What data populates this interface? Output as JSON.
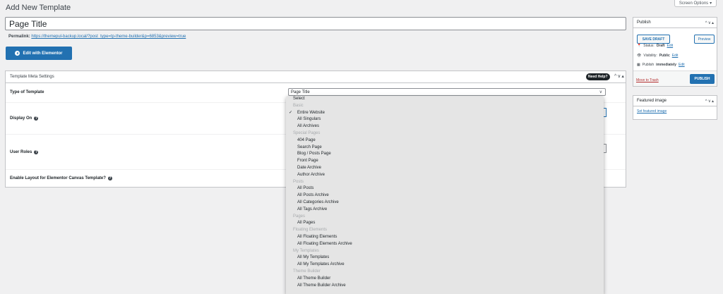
{
  "header": {
    "page_title": "Add New Template",
    "screen_options": "Screen Options"
  },
  "editor": {
    "title_value": "Page Title",
    "permalink_label": "Permalink:",
    "permalink_url": "https://themepul-backup.local/?post_type=tp-theme-builder&p=6853&preview=true",
    "elementor_button": "Edit with Elementor"
  },
  "meta_box": {
    "title": "Template Meta Settings",
    "need_help": "Need Help?",
    "rows": {
      "type_label": "Type of Template",
      "display_label": "Display On",
      "roles_label": "User Roles",
      "canvas_label": "Enable Layout for Elementor Canvas Template?"
    },
    "type_select_value": "Page Title"
  },
  "dropdown": {
    "items": [
      {
        "kind": "top",
        "label": "Select"
      },
      {
        "kind": "group",
        "label": "Basic"
      },
      {
        "kind": "opt",
        "label": "Entire Website",
        "checked": true
      },
      {
        "kind": "opt",
        "label": "All Singulars"
      },
      {
        "kind": "opt",
        "label": "All Archives"
      },
      {
        "kind": "group",
        "label": "Special Pages"
      },
      {
        "kind": "opt",
        "label": "404 Page"
      },
      {
        "kind": "opt",
        "label": "Search Page"
      },
      {
        "kind": "opt",
        "label": "Blog / Posts Page"
      },
      {
        "kind": "opt",
        "label": "Front Page"
      },
      {
        "kind": "opt",
        "label": "Date Archive"
      },
      {
        "kind": "opt",
        "label": "Author Archive"
      },
      {
        "kind": "group",
        "label": "Posts"
      },
      {
        "kind": "opt",
        "label": "All Posts"
      },
      {
        "kind": "opt",
        "label": "All Posts Archive"
      },
      {
        "kind": "opt",
        "label": "All Categories Archive"
      },
      {
        "kind": "opt",
        "label": "All Tags Archive"
      },
      {
        "kind": "group",
        "label": "Pages"
      },
      {
        "kind": "opt",
        "label": "All Pages"
      },
      {
        "kind": "group",
        "label": "Floating Elements"
      },
      {
        "kind": "opt",
        "label": "All Floating Elements"
      },
      {
        "kind": "opt",
        "label": "All Floating Elements Archive"
      },
      {
        "kind": "group",
        "label": "My Templates"
      },
      {
        "kind": "opt",
        "label": "All My Templates"
      },
      {
        "kind": "opt",
        "label": "All My Templates Archive"
      },
      {
        "kind": "group",
        "label": "Theme Builder"
      },
      {
        "kind": "opt",
        "label": "All Theme Builder"
      },
      {
        "kind": "opt",
        "label": "All Theme Builder Archive"
      }
    ]
  },
  "publish": {
    "title": "Publish",
    "save_draft": "SAVE DRAFT",
    "preview": "Preview",
    "status_label": "Status:",
    "status_value": "Draft",
    "visibility_label": "Visibility:",
    "visibility_value": "Public",
    "publish_label": "Publish",
    "publish_value": "immediately",
    "edit": "Edit",
    "move_to_trash": "Move to Trash",
    "publish_button": "PUBLISH"
  },
  "featured_image": {
    "title": "Featured image",
    "set_link": "Set featured image"
  },
  "colors": {
    "accent": "#2271b1",
    "danger": "#b32d2e",
    "background": "#f0f0f1"
  }
}
